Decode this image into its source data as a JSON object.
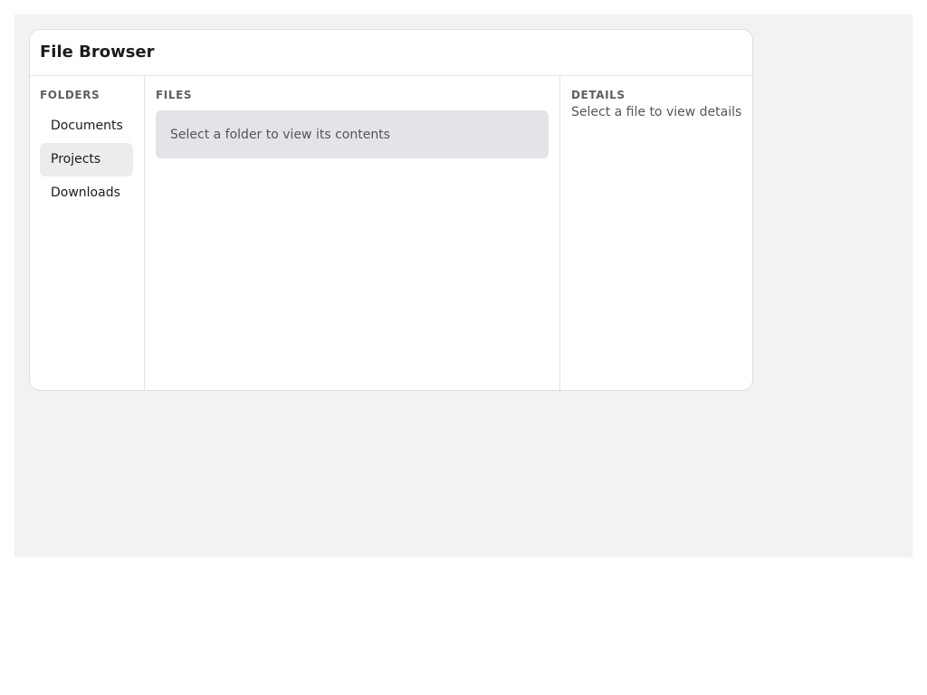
{
  "window": {
    "title": "File Browser"
  },
  "folders": {
    "label": "FOLDERS",
    "items": [
      {
        "label": "Documents",
        "selected": false
      },
      {
        "label": "Projects",
        "selected": true
      },
      {
        "label": "Downloads",
        "selected": false
      }
    ]
  },
  "files": {
    "label": "FILES",
    "empty_message": "Select a folder to view its contents"
  },
  "details": {
    "label": "DETAILS",
    "empty_message": "Select a file to view details"
  },
  "colors": {
    "background": "#f2f2f4",
    "selected_item": "#ececee",
    "empty_box": "#e4e4e8"
  }
}
